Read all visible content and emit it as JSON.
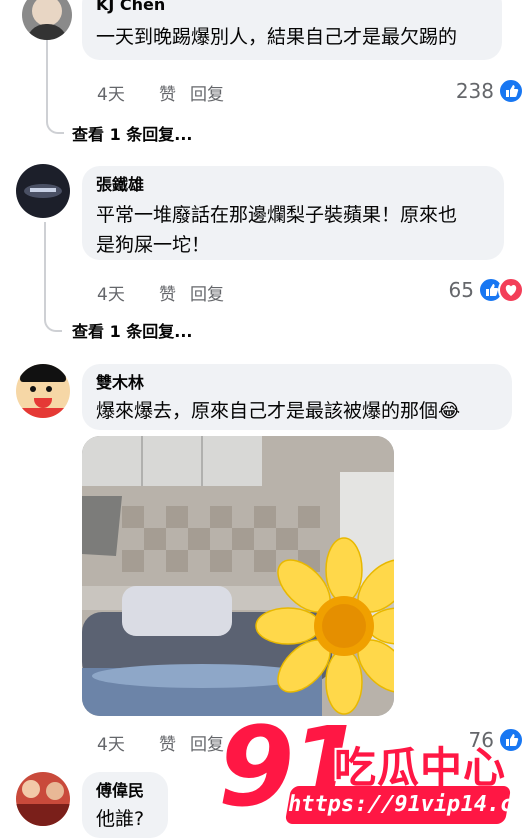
{
  "comments": [
    {
      "author": "KJ Chen",
      "text": "一天到晚踢爆別人，結果自己才是最欠踢的",
      "time": "4天",
      "like_label": "赞",
      "reply_label": "回复",
      "reaction_count": "238",
      "view_replies": "查看 1 条回复..."
    },
    {
      "author": "張鐵雄",
      "text_line1": "平常一堆廢話在那邊爛梨子裝蘋果！原來也",
      "text_line2": "是狗屎一坨！",
      "time": "4天",
      "like_label": "赞",
      "reply_label": "回复",
      "reaction_count": "65",
      "view_replies": "查看 1 条回复..."
    },
    {
      "author": "雙木林",
      "text": "爆來爆去，原來自己才是最該被爆的那個",
      "emoji": "😂",
      "time": "4天",
      "like_label": "赞",
      "reply_label": "回复",
      "reaction_count": "76"
    },
    {
      "author": "傅偉民",
      "text": "他誰?"
    }
  ],
  "watermark": {
    "number": "91",
    "brand": "吃瓜中心",
    "url": "https://91vip14.com"
  },
  "icons": {
    "like": "like-icon",
    "love": "love-icon",
    "sticker": "sunflower-sticker"
  },
  "colors": {
    "bubble": "#f0f2f5",
    "like_blue": "#1877f2",
    "love_red": "#f33e58",
    "meta_gray": "#65676b",
    "watermark_red": "#ff1744"
  }
}
